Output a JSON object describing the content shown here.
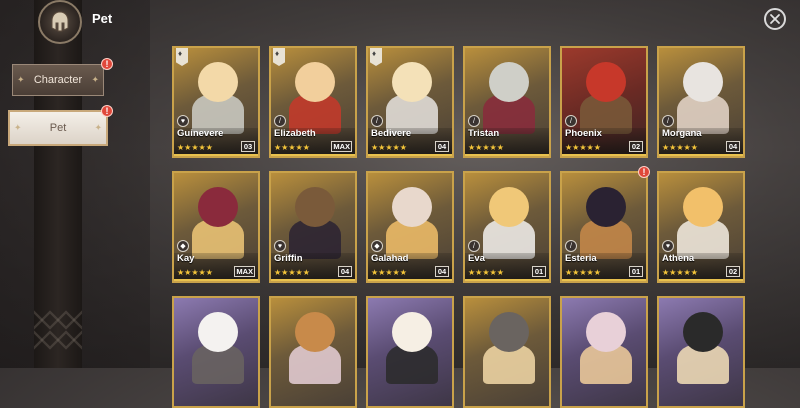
{
  "header": {
    "title": "Pet"
  },
  "nav": {
    "character_label": "Character",
    "pet_label": "Pet",
    "character_badge": "!",
    "pet_badge": "!"
  },
  "colors": {
    "frame_gold": "#c9a24a",
    "star_gold": "#f4c53a",
    "badge_red": "#e0483a",
    "pet_tab_bg": "#f4efe8"
  },
  "cards": [
    {
      "name": "Guinevere",
      "stars": "★★★★★",
      "level": "03",
      "pinned": true,
      "type_icon": "heart-icon",
      "theme": "gold"
    },
    {
      "name": "Elizabeth",
      "stars": "★★★★★",
      "level": "MAX",
      "pinned": true,
      "type_icon": "sword-icon",
      "theme": "gold"
    },
    {
      "name": "Bedivere",
      "stars": "★★★★★",
      "level": "04",
      "pinned": true,
      "type_icon": "sword-icon",
      "theme": "gold"
    },
    {
      "name": "Tristan",
      "stars": "★★★★★",
      "level": "",
      "pinned": false,
      "type_icon": "sword-icon",
      "theme": "gold"
    },
    {
      "name": "Phoenix",
      "stars": "★★★★★",
      "level": "02",
      "pinned": false,
      "type_icon": "sword-icon",
      "theme": "red"
    },
    {
      "name": "Morgana",
      "stars": "★★★★★",
      "level": "04",
      "pinned": false,
      "type_icon": "sword-icon",
      "theme": "gold"
    },
    {
      "name": "Kay",
      "stars": "★★★★★",
      "level": "MAX",
      "pinned": false,
      "type_icon": "shield-icon",
      "theme": "gold"
    },
    {
      "name": "Griffin",
      "stars": "★★★★★",
      "level": "04",
      "pinned": false,
      "type_icon": "heart-icon",
      "theme": "gold"
    },
    {
      "name": "Galahad",
      "stars": "★★★★★",
      "level": "04",
      "pinned": false,
      "type_icon": "shield-icon",
      "theme": "gold"
    },
    {
      "name": "Eva",
      "stars": "★★★★★",
      "level": "01",
      "pinned": false,
      "type_icon": "sword-icon",
      "theme": "gold"
    },
    {
      "name": "Esteria",
      "stars": "★★★★★",
      "level": "01",
      "pinned": false,
      "type_icon": "sword-icon",
      "theme": "gold",
      "badge": "!"
    },
    {
      "name": "Athena",
      "stars": "★★★★★",
      "level": "02",
      "pinned": false,
      "type_icon": "heart-icon",
      "theme": "gold"
    },
    {
      "name": "",
      "stars": "",
      "level": "",
      "pinned": false,
      "type_icon": "",
      "theme": "purple"
    },
    {
      "name": "",
      "stars": "",
      "level": "",
      "pinned": false,
      "type_icon": "",
      "theme": "gold"
    },
    {
      "name": "",
      "stars": "",
      "level": "",
      "pinned": false,
      "type_icon": "",
      "theme": "purple"
    },
    {
      "name": "",
      "stars": "",
      "level": "",
      "pinned": false,
      "type_icon": "",
      "theme": "gold"
    },
    {
      "name": "",
      "stars": "",
      "level": "",
      "pinned": false,
      "type_icon": "",
      "theme": "purple"
    },
    {
      "name": "",
      "stars": "",
      "level": "",
      "pinned": false,
      "type_icon": "",
      "theme": "purple"
    }
  ]
}
